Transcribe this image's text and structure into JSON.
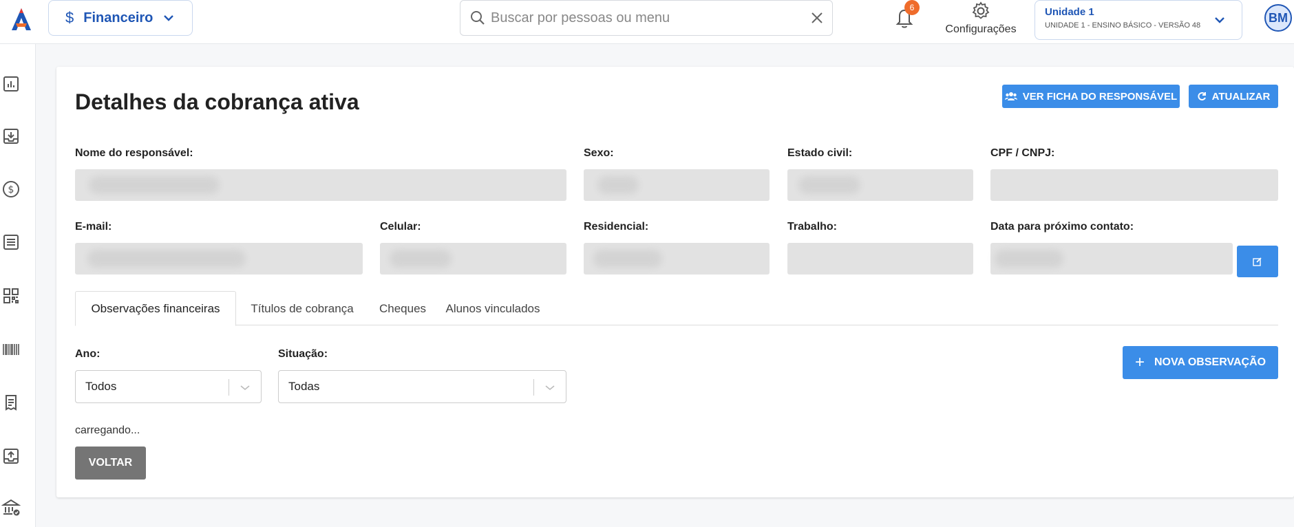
{
  "header": {
    "module_label": "Financeiro",
    "module_symbol": "$",
    "search_placeholder": "Buscar por pessoas ou menu",
    "notifications_count": "6",
    "settings_label": "Configurações",
    "unit_title": "Unidade 1",
    "unit_subtitle": "UNIDADE 1 - ENSINO BÁSICO - VERSÃO 48",
    "avatar_initials": "BM"
  },
  "sidebar": {
    "items": [
      {
        "icon": "chart-icon"
      },
      {
        "icon": "inbox-download-icon"
      },
      {
        "icon": "dollar-circle-icon"
      },
      {
        "icon": "list-document-icon"
      },
      {
        "icon": "qr-code-icon"
      },
      {
        "icon": "barcode-icon"
      },
      {
        "icon": "receipt-icon"
      },
      {
        "icon": "inbox-upload-icon"
      },
      {
        "icon": "bank-check-icon"
      }
    ]
  },
  "page": {
    "title": "Detalhes da cobrança ativa",
    "btn_ficha": "VER FICHA DO RESPONSÁVEL",
    "btn_atualizar": "ATUALIZAR"
  },
  "fields": {
    "nome": {
      "label": "Nome do responsável:",
      "value": ""
    },
    "sexo": {
      "label": "Sexo:",
      "value": ""
    },
    "estado_civil": {
      "label": "Estado civil:",
      "value": ""
    },
    "cpf": {
      "label": "CPF / CNPJ:",
      "value": ""
    },
    "email": {
      "label": "E-mail:",
      "value": ""
    },
    "celular": {
      "label": "Celular:",
      "value": ""
    },
    "residencial": {
      "label": "Residencial:",
      "value": ""
    },
    "trabalho": {
      "label": "Trabalho:",
      "value": ""
    },
    "proximo_contato": {
      "label": "Data para próximo contato:",
      "value": ""
    }
  },
  "tabs": [
    {
      "label": "Observações financeiras",
      "active": true
    },
    {
      "label": "Títulos de cobrança",
      "active": false
    },
    {
      "label": "Cheques",
      "active": false
    },
    {
      "label": "Alunos vinculados",
      "active": false
    }
  ],
  "filters": {
    "ano_label": "Ano:",
    "ano_value": "Todos",
    "situacao_label": "Situação:",
    "situacao_value": "Todas"
  },
  "actions": {
    "new_observation": "NOVA OBSERVAÇÃO",
    "loading_text": "carregando...",
    "back": "VOLTAR"
  },
  "colors": {
    "brand": "#1f56b5",
    "primary_button": "#3b8de8",
    "badge": "#ef6c2b",
    "back_button": "#757575"
  }
}
